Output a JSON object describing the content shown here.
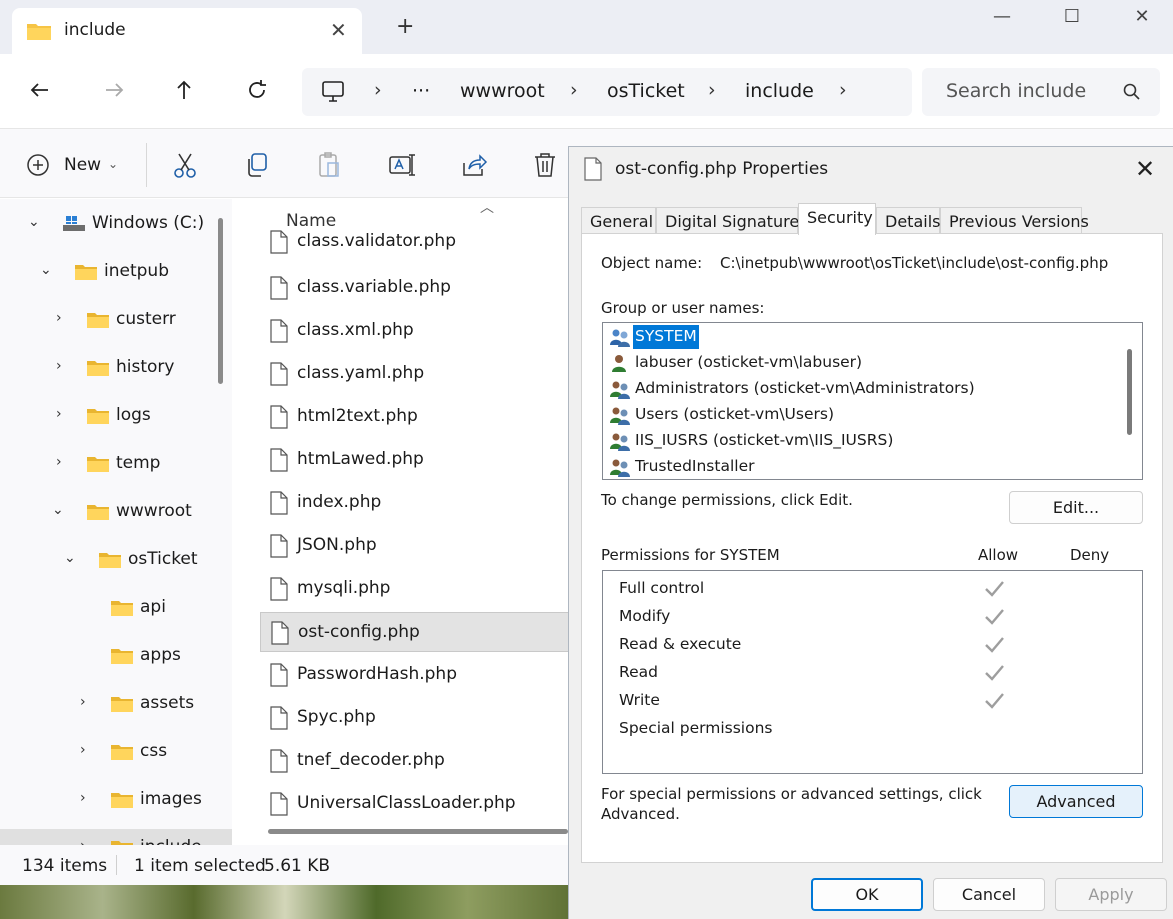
{
  "window": {
    "tab_title": "include",
    "new_tab": "+",
    "minimize": "—",
    "maximize": "☐",
    "close": "✕"
  },
  "address": {
    "breadcrumb": [
      "wwwroot",
      "osTicket",
      "include"
    ],
    "overflow": "···",
    "search_placeholder": "Search include"
  },
  "toolbar": {
    "new_label": "New"
  },
  "nav_tree": [
    {
      "label": "Windows (C:)",
      "level": 0,
      "expanded": true,
      "icon": "drive-icon"
    },
    {
      "label": "inetpub",
      "level": 1,
      "expanded": true,
      "icon": "folder-icon"
    },
    {
      "label": "custerr",
      "level": 2,
      "expanded": false,
      "icon": "folder-icon"
    },
    {
      "label": "history",
      "level": 2,
      "expanded": false,
      "icon": "folder-icon"
    },
    {
      "label": "logs",
      "level": 2,
      "expanded": false,
      "icon": "folder-icon"
    },
    {
      "label": "temp",
      "level": 2,
      "expanded": false,
      "icon": "folder-icon"
    },
    {
      "label": "wwwroot",
      "level": 2,
      "expanded": true,
      "icon": "folder-icon"
    },
    {
      "label": "osTicket",
      "level": 3,
      "expanded": true,
      "icon": "folder-icon"
    },
    {
      "label": "api",
      "level": 4,
      "expanded": null,
      "icon": "folder-icon"
    },
    {
      "label": "apps",
      "level": 4,
      "expanded": null,
      "icon": "folder-icon"
    },
    {
      "label": "assets",
      "level": 4,
      "expanded": false,
      "icon": "folder-icon"
    },
    {
      "label": "css",
      "level": 4,
      "expanded": false,
      "icon": "folder-icon"
    },
    {
      "label": "images",
      "level": 4,
      "expanded": false,
      "icon": "folder-icon"
    },
    {
      "label": "include",
      "level": 4,
      "expanded": false,
      "icon": "folder-icon",
      "selected": true
    }
  ],
  "file_list": {
    "column_name": "Name",
    "files": [
      "class.validator.php",
      "class.variable.php",
      "class.xml.php",
      "class.yaml.php",
      "html2text.php",
      "htmLawed.php",
      "index.php",
      "JSON.php",
      "mysqli.php",
      "ost-config.php",
      "PasswordHash.php",
      "Spyc.php",
      "tnef_decoder.php",
      "UniversalClassLoader.php"
    ],
    "selected_file": "ost-config.php"
  },
  "status": {
    "items_count": "134 items",
    "selection": "1 item selected",
    "size": "5.61 KB"
  },
  "dialog": {
    "title": "ost-config.php Properties",
    "tabs": [
      "General",
      "Digital Signatures",
      "Security",
      "Details",
      "Previous Versions"
    ],
    "active_tab": "Security",
    "object_name_label": "Object name:",
    "object_name_value": "C:\\inetpub\\wwwroot\\osTicket\\include\\ost-config.php",
    "group_label": "Group or user names:",
    "users": [
      "SYSTEM",
      "labuser (osticket-vm\\labuser)",
      "Administrators (osticket-vm\\Administrators)",
      "Users (osticket-vm\\Users)",
      "IIS_IUSRS (osticket-vm\\IIS_IUSRS)",
      "TrustedInstaller"
    ],
    "selected_user": "SYSTEM",
    "change_hint": "To change permissions, click Edit.",
    "edit_button": "Edit...",
    "permissions_label": "Permissions for SYSTEM",
    "allow_header": "Allow",
    "deny_header": "Deny",
    "permissions": [
      {
        "name": "Full control",
        "allow": true,
        "deny": false
      },
      {
        "name": "Modify",
        "allow": true,
        "deny": false
      },
      {
        "name": "Read & execute",
        "allow": true,
        "deny": false
      },
      {
        "name": "Read",
        "allow": true,
        "deny": false
      },
      {
        "name": "Write",
        "allow": true,
        "deny": false
      },
      {
        "name": "Special permissions",
        "allow": false,
        "deny": false
      }
    ],
    "advanced_hint_line1": "For special permissions or advanced settings, click",
    "advanced_hint_line2": "Advanced.",
    "advanced_button": "Advanced",
    "ok_button": "OK",
    "cancel_button": "Cancel",
    "apply_button": "Apply"
  },
  "colors": {
    "folder": "#f6c445",
    "selection_blue": "#0078d7",
    "check_grey": "#9e9e9e"
  }
}
